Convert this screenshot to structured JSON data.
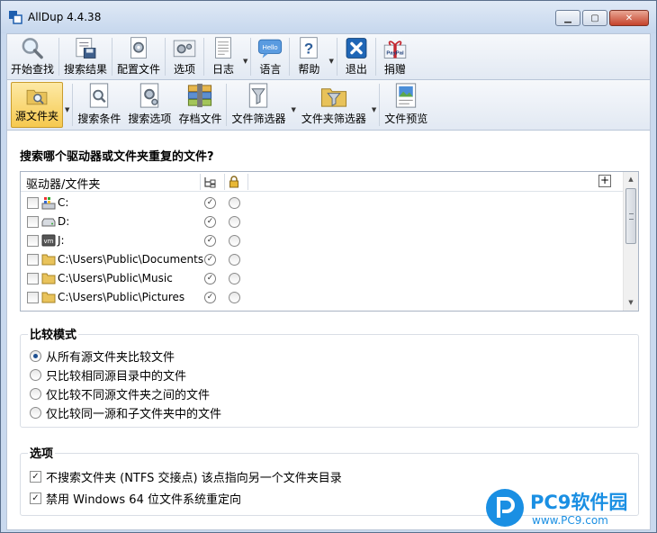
{
  "window": {
    "title": "AllDup 4.4.38"
  },
  "toolbar_main": [
    {
      "label": "开始查找",
      "icon": "magnifier-icon"
    },
    {
      "label": "搜索结果",
      "icon": "results-disk-icon"
    },
    {
      "label": "配置文件",
      "icon": "profile-gear-icon"
    },
    {
      "label": "选项",
      "icon": "options-gear-icon"
    },
    {
      "label": "日志",
      "icon": "log-document-icon"
    },
    {
      "label": "语言",
      "icon": "hello-speech-icon",
      "icon_text": "Hello"
    },
    {
      "label": "帮助",
      "icon": "help-icon"
    },
    {
      "label": "退出",
      "icon": "exit-icon"
    },
    {
      "label": "捐赠",
      "icon": "paypal-gift-icon",
      "icon_text": "PayPal"
    }
  ],
  "toolbar_secondary": [
    {
      "label": "源文件夹",
      "icon": "source-folder-icon",
      "active": true
    },
    {
      "label": "搜索条件",
      "icon": "search-criteria-icon"
    },
    {
      "label": "搜索选项",
      "icon": "search-options-icon"
    },
    {
      "label": "存档文件",
      "icon": "archive-icon"
    },
    {
      "label": "文件筛选器",
      "icon": "file-filter-icon"
    },
    {
      "label": "文件夹筛选器",
      "icon": "folder-filter-icon"
    },
    {
      "label": "文件预览",
      "icon": "file-preview-icon"
    }
  ],
  "main": {
    "question": "搜索哪个驱动器或文件夹重复的文件?",
    "grid": {
      "column_header": "驱动器/文件夹",
      "rows": [
        {
          "label": "C:",
          "icon": "system-drive-icon",
          "checked": false
        },
        {
          "label": "D:",
          "icon": "hard-drive-icon",
          "checked": false
        },
        {
          "label": "J:",
          "icon": "vm-drive-icon",
          "icon_text": "vm",
          "checked": false
        },
        {
          "label": "C:\\Users\\Public\\Documents",
          "icon": "folder-icon",
          "checked": false
        },
        {
          "label": "C:\\Users\\Public\\Music",
          "icon": "folder-icon",
          "checked": false
        },
        {
          "label": "C:\\Users\\Public\\Pictures",
          "icon": "folder-icon",
          "checked": false
        }
      ]
    },
    "compare_mode": {
      "title": "比较模式",
      "options": [
        {
          "label": "从所有源文件夹比较文件",
          "selected": true
        },
        {
          "label": "只比较相同源目录中的文件",
          "selected": false
        },
        {
          "label": "仅比较不同源文件夹之间的文件",
          "selected": false
        },
        {
          "label": "仅比较同一源和子文件夹中的文件",
          "selected": false
        }
      ]
    },
    "options": {
      "title": "选项",
      "items": [
        {
          "label": "不搜索文件夹 (NTFS 交接点) 该点指向另一个文件夹目录",
          "checked": true
        },
        {
          "label": "禁用 Windows 64 位文件系统重定向",
          "checked": true
        }
      ]
    }
  },
  "watermark": {
    "brand": "PC9软件园",
    "url": "www.PC9.com"
  },
  "colors": {
    "accent": "#1d4f91",
    "active_button": "#f6c94f",
    "watermark_blue": "#1a8fe3"
  }
}
